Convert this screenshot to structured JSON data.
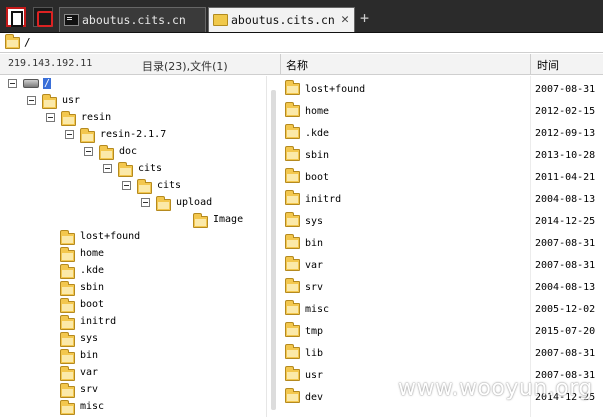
{
  "tabs": [
    {
      "label": "aboutus.cits.cn",
      "icon": "terminal-icon",
      "active": false
    },
    {
      "label": "aboutus.cits.cn",
      "icon": "folder-icon",
      "active": true
    }
  ],
  "new_tab_label": "+",
  "close_glyph": "✕",
  "path_bar": {
    "path": "/"
  },
  "header": {
    "ip": "219.143.192.11",
    "counts": "目录(23),文件(1)",
    "col_name": "名称",
    "col_time": "时间"
  },
  "tree": [
    {
      "label": "/",
      "depth": 0,
      "toggle": true,
      "icon": "drive",
      "selected": true
    },
    {
      "label": "usr",
      "depth": 1,
      "toggle": true
    },
    {
      "label": "resin",
      "depth": 2,
      "toggle": true
    },
    {
      "label": "resin-2.1.7",
      "depth": 3,
      "toggle": true
    },
    {
      "label": "doc",
      "depth": 4,
      "toggle": true
    },
    {
      "label": "cits",
      "depth": 5,
      "toggle": true
    },
    {
      "label": "cits",
      "depth": 6,
      "toggle": true
    },
    {
      "label": "upload",
      "depth": 7,
      "toggle": true
    },
    {
      "label": "Image",
      "depth": 8,
      "toggle": false
    },
    {
      "label": "lost+found",
      "depth": 1,
      "toggle": false
    },
    {
      "label": "home",
      "depth": 1,
      "toggle": false
    },
    {
      "label": ".kde",
      "depth": 1,
      "toggle": false
    },
    {
      "label": "sbin",
      "depth": 1,
      "toggle": false
    },
    {
      "label": "boot",
      "depth": 1,
      "toggle": false
    },
    {
      "label": "initrd",
      "depth": 1,
      "toggle": false
    },
    {
      "label": "sys",
      "depth": 1,
      "toggle": false
    },
    {
      "label": "bin",
      "depth": 1,
      "toggle": false
    },
    {
      "label": "var",
      "depth": 1,
      "toggle": false
    },
    {
      "label": "srv",
      "depth": 1,
      "toggle": false
    },
    {
      "label": "misc",
      "depth": 1,
      "toggle": false
    }
  ],
  "files": [
    {
      "name": "lost+found",
      "time": "2007-08-31"
    },
    {
      "name": "home",
      "time": "2012-02-15"
    },
    {
      "name": ".kde",
      "time": "2012-09-13"
    },
    {
      "name": "sbin",
      "time": "2013-10-28"
    },
    {
      "name": "boot",
      "time": "2011-04-21"
    },
    {
      "name": "initrd",
      "time": "2004-08-13"
    },
    {
      "name": "sys",
      "time": "2014-12-25"
    },
    {
      "name": "bin",
      "time": "2007-08-31"
    },
    {
      "name": "var",
      "time": "2007-08-31"
    },
    {
      "name": "srv",
      "time": "2004-08-13"
    },
    {
      "name": "misc",
      "time": "2005-12-02"
    },
    {
      "name": "tmp",
      "time": "2015-07-20"
    },
    {
      "name": "lib",
      "time": "2007-08-31"
    },
    {
      "name": "usr",
      "time": "2007-08-31"
    },
    {
      "name": "dev",
      "time": "2014-12-25"
    }
  ],
  "watermark": "www.wooyun.org"
}
